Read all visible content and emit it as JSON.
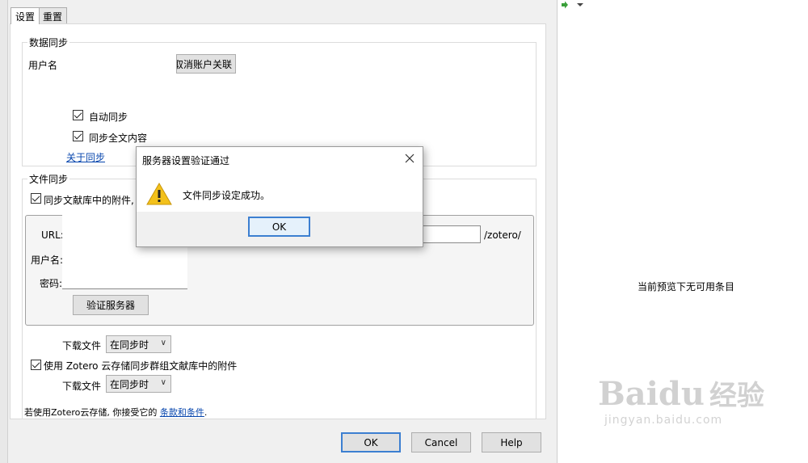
{
  "tabs": [
    {
      "label": "设置"
    },
    {
      "label": "重置"
    }
  ],
  "data_sync": {
    "legend": "数据同步",
    "username_label": "用户名",
    "unlink_button": "取消账户关联",
    "auto_sync": "自动同步",
    "sync_fulltext": "同步全文内容",
    "about_link": "关于同步"
  },
  "file_sync": {
    "legend": "文件同步",
    "sync_attachments_label": "同步文献库中的附件,",
    "url_label": "URL:",
    "url_suffix": "/zotero/",
    "username_label": "用户名:",
    "password_label": "密码:",
    "verify_button": "验证服务器",
    "download_label": "下载文件",
    "download_value": "在同步时",
    "group_attachments_label": "使用 Zotero 云存储同步群组文献库中的附件",
    "download_label_2": "下载文件",
    "download_value_2": "在同步时",
    "terms_prefix": "若使用Zotero云存储, 你接受它的",
    "terms_link": "条款和条件",
    "terms_suffix": "."
  },
  "footer": {
    "ok": "OK",
    "cancel": "Cancel",
    "help": "Help"
  },
  "alert": {
    "title": "服务器设置验证通过",
    "message": "文件同步设定成功。",
    "ok": "OK"
  },
  "preview": {
    "empty_text": "当前预览下无可用条目"
  },
  "watermark": {
    "brand": "Baidu",
    "cn": "经验",
    "url": "jingyan.baidu.com"
  },
  "colors": {
    "accent": "#3c7fd1",
    "link": "#0645ad"
  }
}
